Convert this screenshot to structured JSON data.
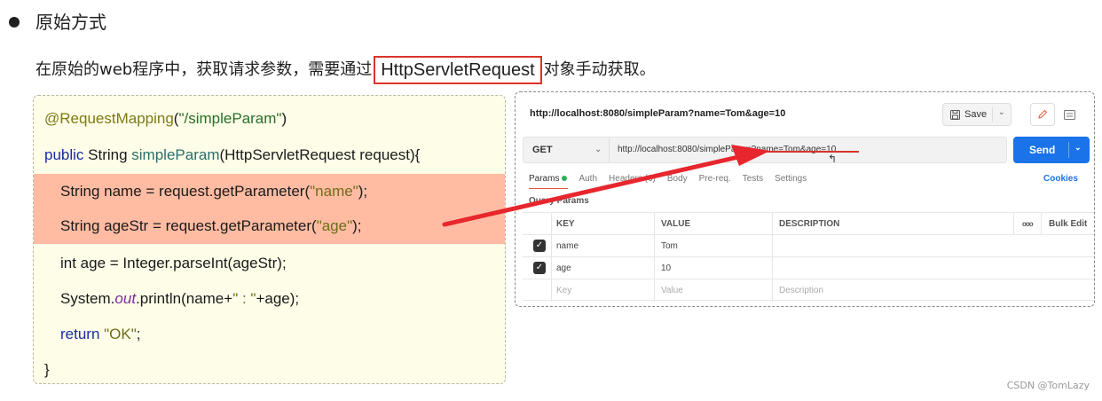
{
  "section": {
    "heading": "原始方式",
    "desc_before": "在原始的web程序中，获取请求参数，需要通过",
    "desc_highlight": "HttpServletRequest",
    "desc_after": " 对象手动获取。"
  },
  "code": {
    "l1": {
      "ann": "@RequestMapping",
      "open": "(",
      "str": "\"/simpleParam\"",
      "close": ")"
    },
    "l2": {
      "kw": "public",
      "type": " String ",
      "fn": "simpleParam",
      "rest": "(HttpServletRequest request){"
    },
    "l3": {
      "pre": "String name = request.getParameter(",
      "str": "\"name\"",
      "post": ");"
    },
    "l4": {
      "pre": "String ageStr = request.getParameter(",
      "str": "\"age\"",
      "post": ");"
    },
    "l5": {
      "text": "int age = Integer.parseInt(ageStr);"
    },
    "l6": {
      "pre": "System.",
      "it": "out",
      "mid": ".println(name+",
      "str": "\"  :  \"",
      "post": "+age);"
    },
    "l7": {
      "kw": "return",
      "str": " \"OK\"",
      "post": ";"
    },
    "l8": {
      "text": "}"
    }
  },
  "postman": {
    "title": "http://localhost:8080/simpleParam?name=Tom&age=10",
    "save_label": "Save",
    "method": "GET",
    "url": "http://localhost:8080/simpleParam?name=Tom&age=10",
    "send_label": "Send",
    "tabs": {
      "params": "Params",
      "auth": "Auth",
      "headers": "Headers (6)",
      "body": "Body",
      "prereq": "Pre-req.",
      "tests": "Tests",
      "settings": "Settings"
    },
    "cookies": "Cookies",
    "query_params": "Query Params",
    "columns": {
      "key": "KEY",
      "value": "VALUE",
      "description": "DESCRIPTION",
      "more": "ooo",
      "bulk_edit": "Bulk Edit"
    },
    "rows": [
      {
        "key": "name",
        "value": "Tom",
        "description": ""
      },
      {
        "key": "age",
        "value": "10",
        "description": ""
      }
    ],
    "placeholder": {
      "key": "Key",
      "value": "Value",
      "description": "Description"
    }
  },
  "watermark": "CSDN @TomLazy",
  "colors": {
    "highlight_box": "#d9342b",
    "code_bg": "#fefde8",
    "code_highlight": "#ffbca3",
    "send_button": "#1a73e8",
    "arrow": "#e8262d"
  }
}
